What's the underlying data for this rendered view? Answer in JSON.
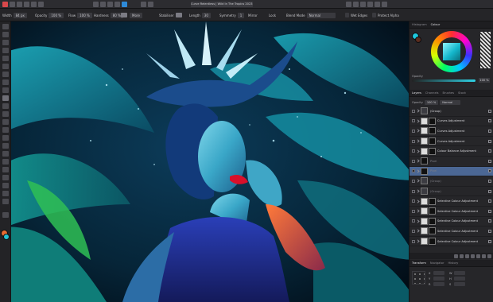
{
  "app": {
    "document_title": "Curve Relentless | Wild In The Tropics 2023 · ..."
  },
  "context_toolbar": {
    "width_label": "Width",
    "width_value": "84 px",
    "opacity_label": "Opacity",
    "opacity_value": "100 %",
    "flow_label": "Flow",
    "flow_value": "100 %",
    "hardness_label": "Hardness",
    "hardness_value": "80 %",
    "more_label": "More",
    "stabiliser_label": "Stabiliser",
    "length_label": "Length",
    "length_value": "30",
    "symmetry_label": "Symmetry",
    "symmetry_value": "1",
    "mirror_label": "Mirror",
    "lock_label": "Lock",
    "blend_label": "Blend Mode",
    "blend_value": "Normal",
    "wet_edges_label": "Wet Edges",
    "protect_alpha_label": "Protect Alpha"
  },
  "color_panel": {
    "tabs": [
      "Histogram",
      "Colour"
    ],
    "active_tab": "Colour",
    "opacity_label": "Opacity",
    "opacity_value": "100 %",
    "current_color": "#1ec8dc",
    "previous_color": "#5a2c1e"
  },
  "layers_panel": {
    "tabs": [
      "Layers",
      "Channels",
      "Brushes",
      "Stock"
    ],
    "active_tab": "Layers",
    "opacity_label": "Opacity",
    "opacity_value": "100 %",
    "blend_value": "Normal",
    "layers": [
      {
        "name": "(Group)",
        "thumb": "folder",
        "dim": false,
        "selected": false
      },
      {
        "name": "Curves Adjustment",
        "thumb": "white",
        "dim": false,
        "selected": false
      },
      {
        "name": "Curves Adjustment",
        "thumb": "white",
        "dim": false,
        "selected": false
      },
      {
        "name": "Curves Adjustment",
        "thumb": "white",
        "dim": false,
        "selected": false
      },
      {
        "name": "Colour Balance Adjustment",
        "thumb": "white",
        "dim": false,
        "selected": false
      },
      {
        "name": "Pixel",
        "thumb": "dark",
        "dim": true,
        "selected": false
      },
      {
        "name": "Pixel",
        "thumb": "dark",
        "dim": true,
        "selected": true
      },
      {
        "name": "(Group)",
        "thumb": "folder",
        "dim": true,
        "selected": false
      },
      {
        "name": "(Group)",
        "thumb": "folder",
        "dim": true,
        "selected": false
      },
      {
        "name": "Selective Colour Adjustment",
        "thumb": "white",
        "dim": false,
        "selected": false
      },
      {
        "name": "Selective Colour Adjustment",
        "thumb": "white",
        "dim": false,
        "selected": false
      },
      {
        "name": "Selective Colour Adjustment",
        "thumb": "white",
        "dim": false,
        "selected": false
      },
      {
        "name": "Selective Colour Adjustment",
        "thumb": "white",
        "dim": false,
        "selected": false
      },
      {
        "name": "Selective Colour Adjustment",
        "thumb": "white",
        "dim": false,
        "selected": false
      }
    ]
  },
  "transform_panel": {
    "tabs": [
      "Transform",
      "Navigator",
      "History"
    ],
    "active_tab": "Transform",
    "x_label": "X",
    "y_label": "Y",
    "w_label": "W",
    "h_label": "H",
    "r_label": "R",
    "s_label": "S"
  }
}
